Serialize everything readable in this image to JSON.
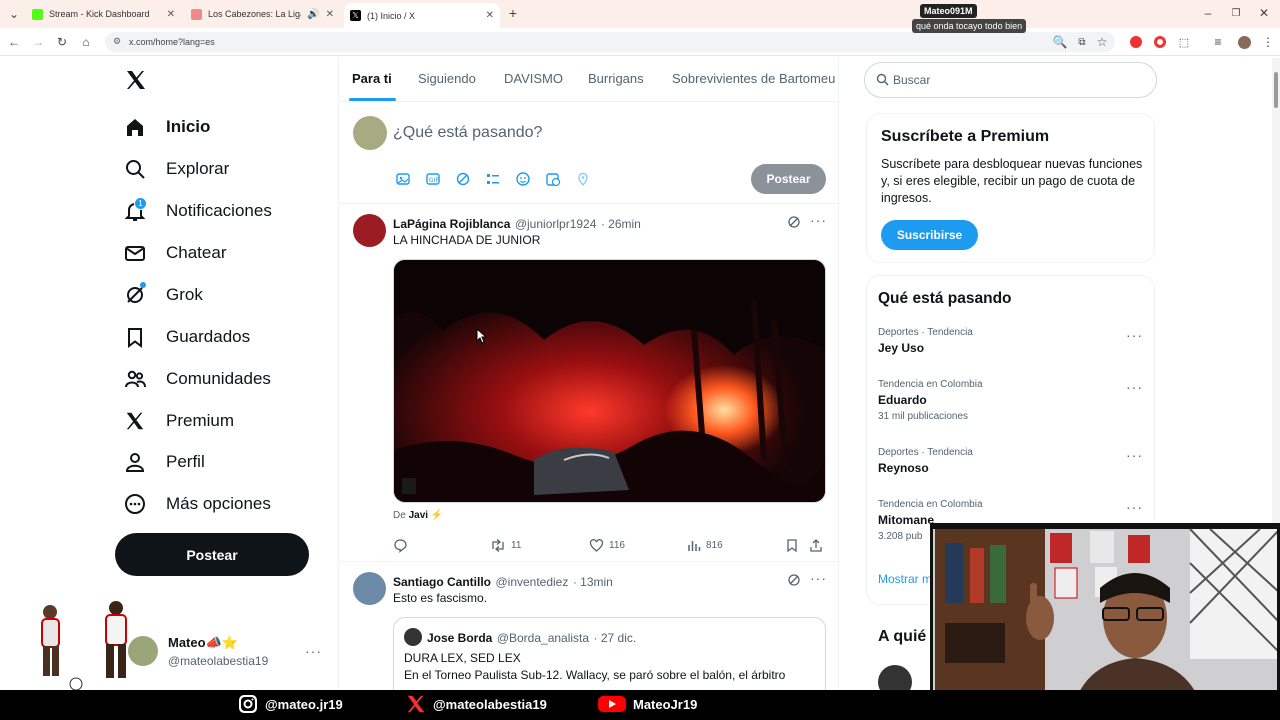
{
  "browser": {
    "tabs": [
      {
        "title": "Stream - Kick Dashboard",
        "favicon_color": "#53fc18"
      },
      {
        "title": "Los Cabezones: La Liga de",
        "favicon_color": "#e55"
      },
      {
        "title": "(1) Inicio / X",
        "favicon_color": "#000000"
      }
    ],
    "url": "x.com/home?lang=es"
  },
  "chat_popup": {
    "user": "Mateo091M",
    "message": "qué onda tocayo todo bien"
  },
  "sidebar": {
    "items": [
      {
        "label": "Inicio",
        "icon": "home-icon"
      },
      {
        "label": "Explorar",
        "icon": "search-icon"
      },
      {
        "label": "Notificaciones",
        "icon": "bell-icon",
        "badge": "1"
      },
      {
        "label": "Chatear",
        "icon": "mail-icon"
      },
      {
        "label": "Grok",
        "icon": "grok-icon"
      },
      {
        "label": "Guardados",
        "icon": "bookmark-icon"
      },
      {
        "label": "Comunidades",
        "icon": "people-icon"
      },
      {
        "label": "Premium",
        "icon": "x-logo-icon"
      },
      {
        "label": "Perfil",
        "icon": "person-icon"
      },
      {
        "label": "Más opciones",
        "icon": "more-circle-icon"
      }
    ],
    "post_label": "Postear",
    "account": {
      "name": "Mateo📣⭐",
      "handle": "@mateolabestia19"
    }
  },
  "feed": {
    "tabs": [
      "Para ti",
      "Siguiendo",
      "DAVISMO",
      "Burrigans",
      "Sobrevivientes de Bartomeu"
    ],
    "compose_placeholder": "¿Qué está pasando?",
    "compose_button": "Postear",
    "tweets": [
      {
        "name": "LaPágina Rojiblanca",
        "handle": "@juniorlpr1924",
        "time": "· 26min",
        "text": "LA HINCHADA DE JUNIOR",
        "media_credit_prefix": "De",
        "media_credit_name": "Javi ⚡",
        "replies": "",
        "retweets": "11",
        "likes": "116",
        "views": "816"
      },
      {
        "name": "Santiago Cantillo",
        "handle": "@inventediez",
        "time": "· 13min",
        "text": "Esto es fascismo.",
        "quote": {
          "name": "Jose Borda",
          "handle": "@Borda_analista",
          "time": "· 27 dic.",
          "line1": "DURA LEX, SED LEX",
          "line2": "En el Torneo Paulista Sub-12. Wallacy, se paró sobre el balón, el árbitro"
        }
      }
    ]
  },
  "right": {
    "search_placeholder": "Buscar",
    "premium": {
      "title": "Suscríbete a Premium",
      "body": "Suscríbete para desbloquear nuevas funciones y, si eres elegible, recibir un pago de cuota de ingresos.",
      "button": "Suscribirse"
    },
    "trends_title": "Qué está pasando",
    "trends": [
      {
        "category": "Deportes · Tendencia",
        "name": "Jey Uso",
        "count": ""
      },
      {
        "category": "Tendencia en Colombia",
        "name": "Eduardo",
        "count": "31 mil publicaciones"
      },
      {
        "category": "Deportes · Tendencia",
        "name": "Reynoso",
        "count": ""
      },
      {
        "category": "Tendencia en Colombia",
        "name": "Mitomane",
        "count": "3.208 pub"
      }
    ],
    "show_more": "Mostrar m",
    "who_to_follow": "A quié"
  },
  "overlay": {
    "instagram": "@mateo.jr19",
    "x": "@mateolabestia19",
    "youtube": "MateoJr19"
  },
  "colors": {
    "accent": "#1d9bf0",
    "text": "#0f1419",
    "muted": "#536471"
  }
}
